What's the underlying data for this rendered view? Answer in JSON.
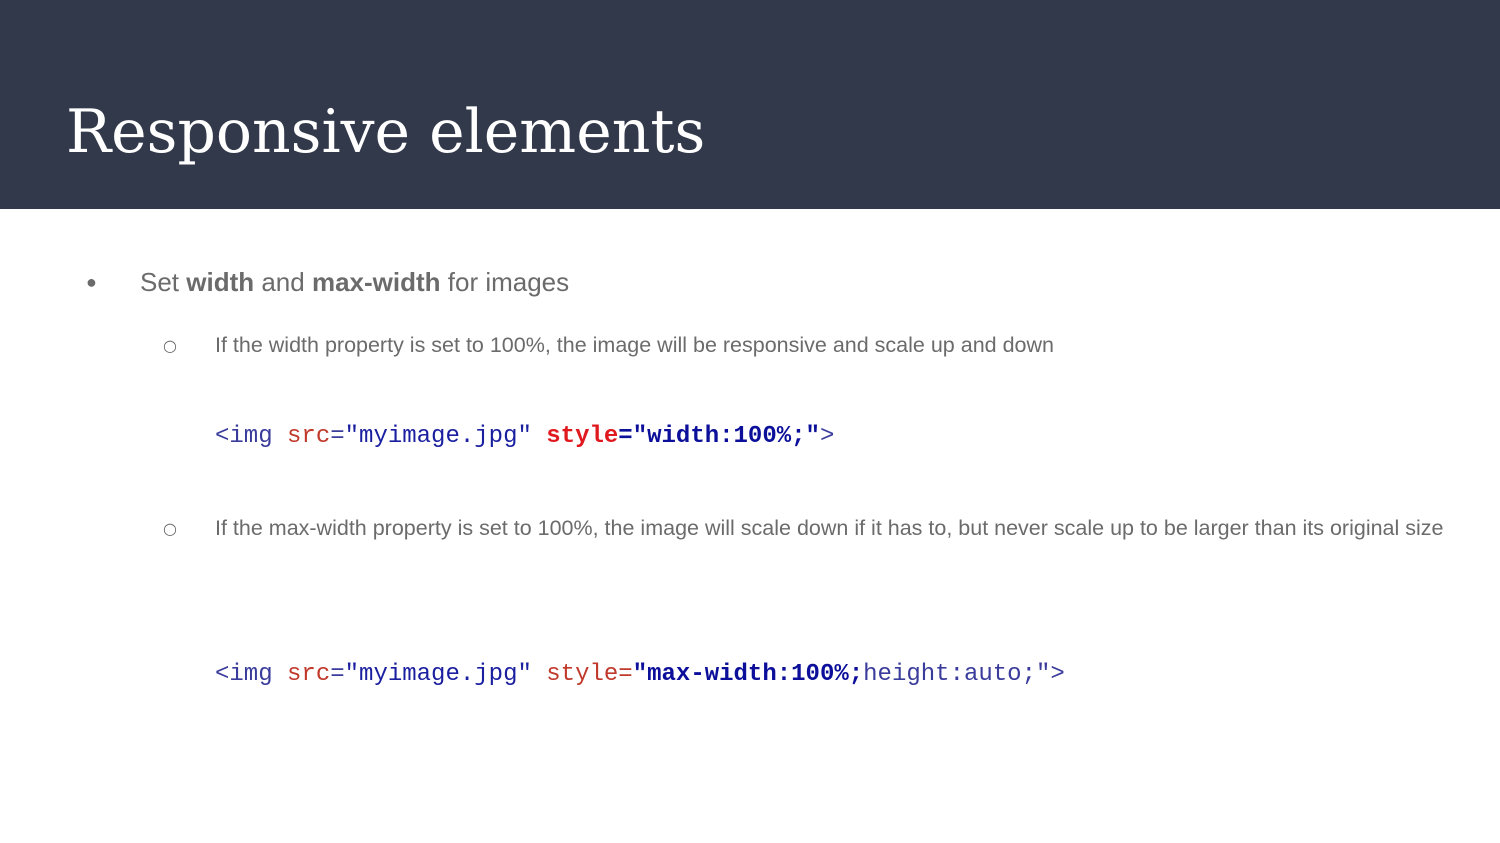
{
  "slide": {
    "title": "Responsive elements",
    "bullet_glyph": "●",
    "sub_bullet_glyph": "○",
    "point1": {
      "prefix": "Set ",
      "bold1": "width",
      "middle": " and ",
      "bold2": "max-width",
      "suffix": " for images"
    },
    "sub1": {
      "text": "If the width property is set to 100%, the image will be responsive and scale up and down",
      "code": {
        "open": "<img",
        "sp1": " ",
        "attr1": "src",
        "eq1": "=",
        "val1": "\"myimage.jpg\"",
        "sp2": " ",
        "attr2": "style",
        "eq2": "=",
        "val2": "\"width:100%;\"",
        "close": ">"
      }
    },
    "sub2": {
      "text": "If the max-width property is set to 100%, the image will scale down if it has to, but never scale up to be larger than its original size",
      "code": {
        "open": "<img",
        "sp1": " ",
        "attr1": "src",
        "eq1": "=",
        "val1": "\"myimage.jpg\"",
        "sp2": " ",
        "attr2": "style",
        "eq2": "=",
        "quote_open": "\"",
        "val2_bold": "max-width:100%;",
        "val2_rest": "height:auto;\"",
        "close": ">"
      }
    }
  },
  "colors": {
    "header_bg": "#32394b",
    "title_text": "#ffffff",
    "body_text": "#6b6b6b",
    "code_tag": "#3a3c9c",
    "code_attr": "#c0392b",
    "code_value": "#1a1fa0",
    "code_highlight_attr": "#e0191f",
    "code_highlight_value": "#0c0f9a"
  }
}
